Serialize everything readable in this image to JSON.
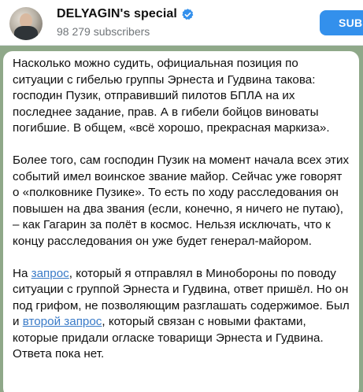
{
  "channel": {
    "title": "DELYAGIN's special",
    "subscribers": "98 279 subscribers",
    "verified_icon": "verified-badge-icon",
    "subscribe_label": "SUBS"
  },
  "message": {
    "p1": "Насколько можно судить, официальная позиция по ситуации с гибелью группы Эрнеста и Гудвина такова: господин Пузик, отправивший пилотов БПЛА на их последнее задание, прав. А в гибели бойцов виноваты погибшие. В общем, «всё хорошо, прекрасная маркиза».",
    "p2": "Более того, сам господин Пузик на момент начала всех этих событий имел воинское звание майор. Сейчас уже говорят о «полковнике Пузике». То есть по ходу расследования он повышен на два звания (если, конечно, я ничего не путаю), – как Гагарин за полёт в космос. Нельзя исключать, что к концу расследования он уже будет генерал-майором.",
    "p3_a": "На ",
    "p3_link1": "запрос",
    "p3_b": ", который я отправлял в Минобороны по поводу ситуации с группой Эрнеста и Гудвина, ответ пришёл. Но он под грифом, не позволяющим разглашать содержимое. Был и ",
    "p3_link2": "второй запрос",
    "p3_c": ", который связан с новыми фактами, которые придали огласке товарищи Эрнеста и Гудвина. Ответа пока нет."
  },
  "colors": {
    "accent": "#3390ec",
    "link": "#3a7bc8",
    "background": "#8fa889"
  }
}
